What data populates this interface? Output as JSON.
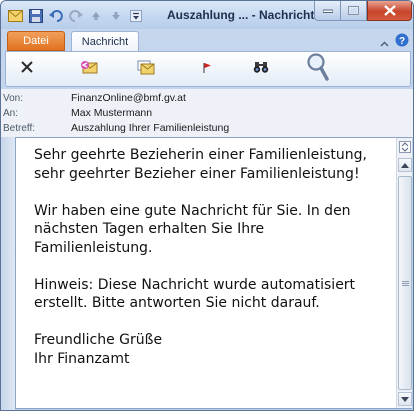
{
  "window": {
    "title": "Auszahlung ... - Nachricht",
    "colors": {
      "file_tab": "#e0721f",
      "close": "#c8452c",
      "titlebar": "#c3d6ef"
    }
  },
  "qat": {
    "icons": [
      "mail-icon",
      "save-icon",
      "undo-icon",
      "redo-icon",
      "up-arrow-icon",
      "down-arrow-icon",
      "customize-icon"
    ]
  },
  "tabs": {
    "file": "Datei",
    "message": "Nachricht"
  },
  "ribbon": {
    "icons": [
      "delete-icon",
      "reply-icon",
      "forward-icon",
      "flag-icon",
      "find-icon",
      "zoom-icon"
    ]
  },
  "header": {
    "from_label": "Von:",
    "from_value": "FinanzOnline@bmf.gv.at",
    "to_label": "An:",
    "to_value": "Max Mustermann",
    "subject_label": "Betreff:",
    "subject_value": "Auszahlung Ihrer Familienleistung"
  },
  "body": {
    "p1": "Sehr geehrte Bezieherin einer Familienleistung, sehr geehrter Bezieher einer Familienleistung!",
    "p2": "Wir haben eine gute Nachricht für Sie. In den nächsten Tagen erhalten Sie Ihre Familienleistung.",
    "p3": "Hinweis: Diese Nachricht wurde automatisiert erstellt. Bitte antworten Sie nicht darauf.",
    "p4a": "Freundliche Grüße",
    "p4b": "Ihr Finanzamt"
  }
}
